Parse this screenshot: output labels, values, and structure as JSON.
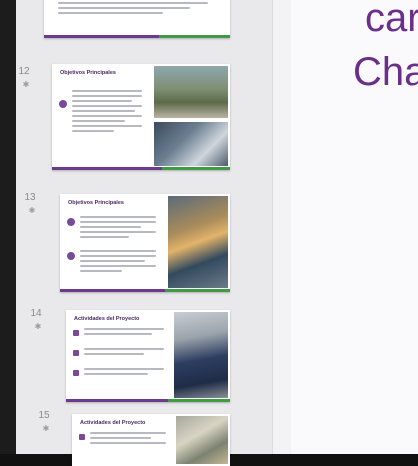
{
  "panel": {
    "slides": [
      {
        "number": "",
        "title": ""
      },
      {
        "number": "12",
        "title": "Objetivos Principales"
      },
      {
        "number": "13",
        "title": "Objetivos Principales"
      },
      {
        "number": "14",
        "title": "Actividades del Proyecto"
      },
      {
        "number": "15",
        "title": "Actividades del Proyecto"
      }
    ]
  },
  "canvas": {
    "text_line1": "car",
    "text_line2": "Cha"
  },
  "colors": {
    "accent_purple": "#6b3a8c",
    "accent_green": "#3f9a44",
    "title_text": "#6a2f8a"
  }
}
